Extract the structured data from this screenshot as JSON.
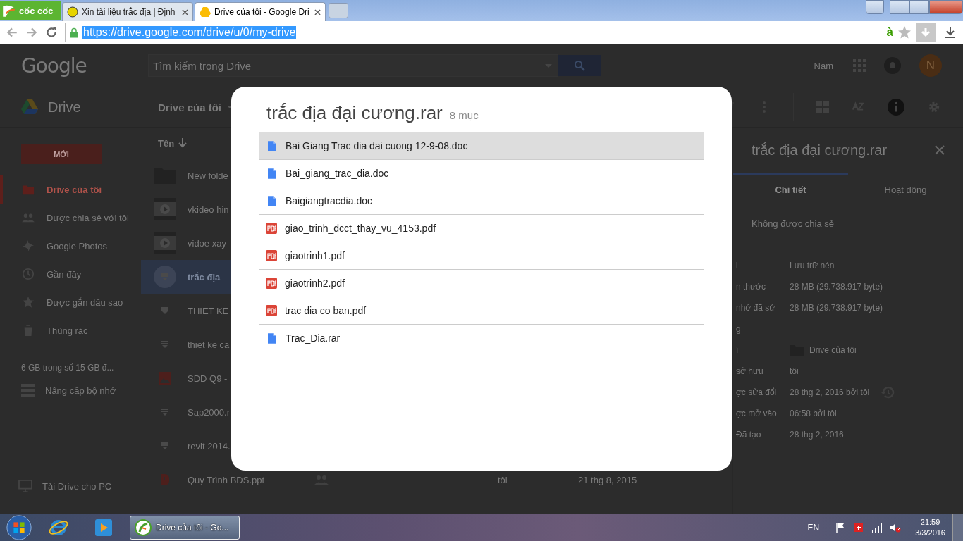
{
  "browser": {
    "logo": "cốc cốc",
    "tabs": [
      {
        "title": "Xin tài liệu trắc địa | Định",
        "selected": false
      },
      {
        "title": "Drive của tôi - Google Dri",
        "selected": true
      }
    ],
    "url": "https://drive.google.com/drive/u/0/my-drive",
    "lang_badge": "à"
  },
  "drive_header": {
    "logo": "Google",
    "search_placeholder": "Tìm kiếm trong Drive",
    "user": "Nam",
    "avatar": "N"
  },
  "toolbar": {
    "app": "Drive",
    "location": "Drive của tôi"
  },
  "sidebar": {
    "new_button": "MỚI",
    "items": [
      {
        "label": "Drive của tôi",
        "kind": "drive",
        "selected": true
      },
      {
        "label": "Được chia sẻ với tôi",
        "kind": "shared",
        "selected": false
      },
      {
        "label": "Google Photos",
        "kind": "photos",
        "selected": false
      },
      {
        "label": "Gần đây",
        "kind": "recent",
        "selected": false
      },
      {
        "label": "Được gắn dấu sao",
        "kind": "star",
        "selected": false
      },
      {
        "label": "Thùng rác",
        "kind": "trash",
        "selected": false
      }
    ],
    "storage": "6 GB trong số 15 GB đ...",
    "upgrade": "Nâng cấp bộ nhớ",
    "download": "Tải Drive cho PC"
  },
  "files": {
    "column": "Tên",
    "rows": [
      {
        "name": "New folde",
        "kind": "folder",
        "selected": false
      },
      {
        "name": "vkideo hin",
        "kind": "video",
        "selected": false
      },
      {
        "name": "vidoe xay",
        "kind": "video",
        "selected": false
      },
      {
        "name": "trắc địa",
        "kind": "archive",
        "selected": true
      },
      {
        "name": "THIET KE",
        "kind": "archive",
        "selected": false
      },
      {
        "name": "thiet ke ca",
        "kind": "archive",
        "selected": false
      },
      {
        "name": "SDD Q9 -",
        "kind": "image",
        "selected": false
      },
      {
        "name": "Sap2000.r",
        "kind": "archive",
        "selected": false
      },
      {
        "name": "revit 2014.",
        "kind": "archive",
        "selected": false
      },
      {
        "name": "Quy Trình BĐS.ppt",
        "kind": "slides",
        "selected": false,
        "shared": true,
        "owner": "tôi",
        "date": "21 thg 8, 2015"
      }
    ]
  },
  "details": {
    "title": "trắc địa đại cương.rar",
    "tabs": [
      {
        "label": "Chi tiết",
        "selected": true
      },
      {
        "label": "Hoạt động",
        "selected": false
      }
    ],
    "sharing": "Không được chia sẻ",
    "properties": [
      {
        "label": "i",
        "value": "Lưu trữ nén"
      },
      {
        "label": "n thước",
        "value": "28 MB (29.738.917 byte)"
      },
      {
        "label": "nhớ đã sử",
        "value": "28 MB (29.738.917 byte)"
      },
      {
        "label": "g"
      },
      {
        "label": "í",
        "kind": "folder",
        "value": "Drive của tôi"
      },
      {
        "label": "sở hữu",
        "value": "tôi"
      },
      {
        "label": "ợc sửa đổi",
        "kind": "history",
        "value": "28 thg 2, 2016 bởi tôi"
      },
      {
        "label": "ợc mở vào",
        "value": "06:58 bởi tôi"
      },
      {
        "label": "Đã tạo",
        "value": "28 thg 2, 2016"
      }
    ]
  },
  "dialog": {
    "title": "trắc địa đại cương.rar",
    "count": "8 mục",
    "items": [
      {
        "name": "Bai Giang Trac dia dai cuong 12-9-08.doc",
        "kind": "doc",
        "selected": true
      },
      {
        "name": "Bai_giang_trac_dia.doc",
        "kind": "doc",
        "selected": false
      },
      {
        "name": "Baigiangtracdia.doc",
        "kind": "doc",
        "selected": false
      },
      {
        "name": "giao_trinh_dcct_thay_vu_4153.pdf",
        "kind": "pdf",
        "selected": false
      },
      {
        "name": "giaotrinh1.pdf",
        "kind": "pdf",
        "selected": false
      },
      {
        "name": "giaotrinh2.pdf",
        "kind": "pdf",
        "selected": false
      },
      {
        "name": "trac dia co ban.pdf",
        "kind": "pdf",
        "selected": false
      },
      {
        "name": "Trac_Dia.rar",
        "kind": "doc",
        "selected": false
      }
    ]
  },
  "taskbar": {
    "task": "Drive của tôi - Go...",
    "language": "EN",
    "time": "21:59",
    "date": "3/3/2016"
  }
}
